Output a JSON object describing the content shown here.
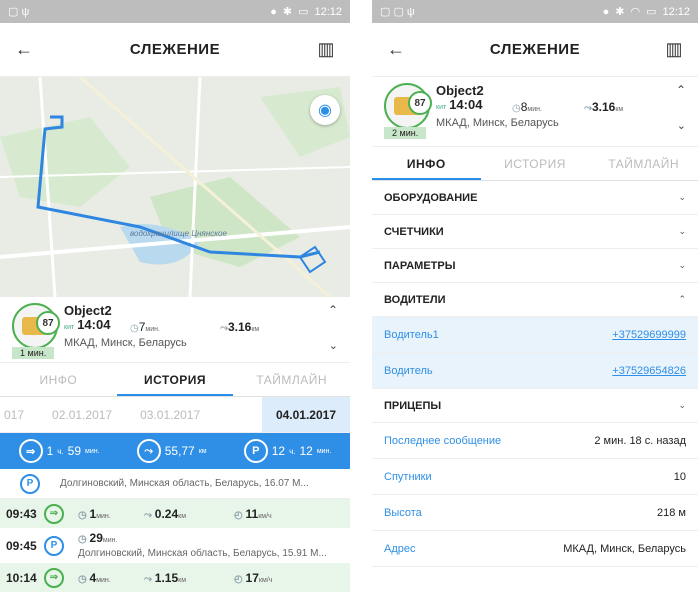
{
  "status": {
    "time": "12:12"
  },
  "left": {
    "title": "СЛЕЖЕНИЕ",
    "map_label": "водохранилище Цнянское",
    "object": {
      "name": "Object2",
      "speed": "87",
      "time": "14:04",
      "time_prefix": "кит",
      "duration": "7",
      "duration_unit": "мин.",
      "distance": "3.16",
      "distance_unit": "км",
      "address": "МКАД, Минск, Беларусь",
      "badge": "1 мин."
    },
    "tabs": [
      "ИНФО",
      "ИСТОРИЯ",
      "ТАЙМЛАЙН"
    ],
    "dates": [
      "017",
      "02.01.2017",
      "03.01.2017",
      "04.01.2017"
    ],
    "summary": {
      "moves": "1",
      "moves_h": "ч.",
      "moves_min": "59",
      "moves_unit": "мин.",
      "distance": "55,77",
      "distance_unit": "км",
      "parking": "12",
      "parking_h": "ч.",
      "parking_min": "12",
      "parking_unit": "мин."
    },
    "stop_first": "Долгиновский, Минская область, Беларусь, 16.07 М...",
    "events": [
      {
        "time": "09:43",
        "type": "move",
        "duration": "1",
        "duration_unit": "мин.",
        "distance": "0.24",
        "distance_unit": "км",
        "speed": "11",
        "speed_unit": "км/ч"
      },
      {
        "time": "09:45",
        "type": "stop",
        "duration": "29",
        "duration_unit": "мин.",
        "address": "Долгиновский, Минская область, Беларусь, 15.91 М..."
      },
      {
        "time": "10:14",
        "type": "move",
        "duration": "4",
        "duration_unit": "мин.",
        "distance": "1.15",
        "distance_unit": "км",
        "speed": "17",
        "speed_unit": "км/ч"
      }
    ]
  },
  "right": {
    "title": "СЛЕЖЕНИЕ",
    "object": {
      "name": "Object2",
      "speed": "87",
      "time": "14:04",
      "time_prefix": "кит",
      "duration": "8",
      "duration_unit": "мин.",
      "distance": "3.16",
      "distance_unit": "км",
      "address": "МКАД, Минск, Беларусь",
      "badge": "2 мин."
    },
    "tabs": [
      "ИНФО",
      "ИСТОРИЯ",
      "ТАЙМЛАЙН"
    ],
    "sections": [
      "ОБОРУДОВАНИЕ",
      "СЧЕТЧИКИ",
      "ПАРАМЕТРЫ",
      "ВОДИТЕЛИ"
    ],
    "drivers": [
      {
        "name": "Водитель1",
        "phone": "+37529699999"
      },
      {
        "name": "Водитель",
        "phone": "+37529654826"
      }
    ],
    "trailers": "ПРИЦЕПЫ",
    "info": [
      {
        "key": "Последнее сообщение",
        "value": "2 мин. 18 с. назад"
      },
      {
        "key": "Спутники",
        "value": "10"
      },
      {
        "key": "Высота",
        "value": "218 м"
      },
      {
        "key": "Адрес",
        "value": "МКАД, Минск, Беларусь"
      }
    ]
  }
}
